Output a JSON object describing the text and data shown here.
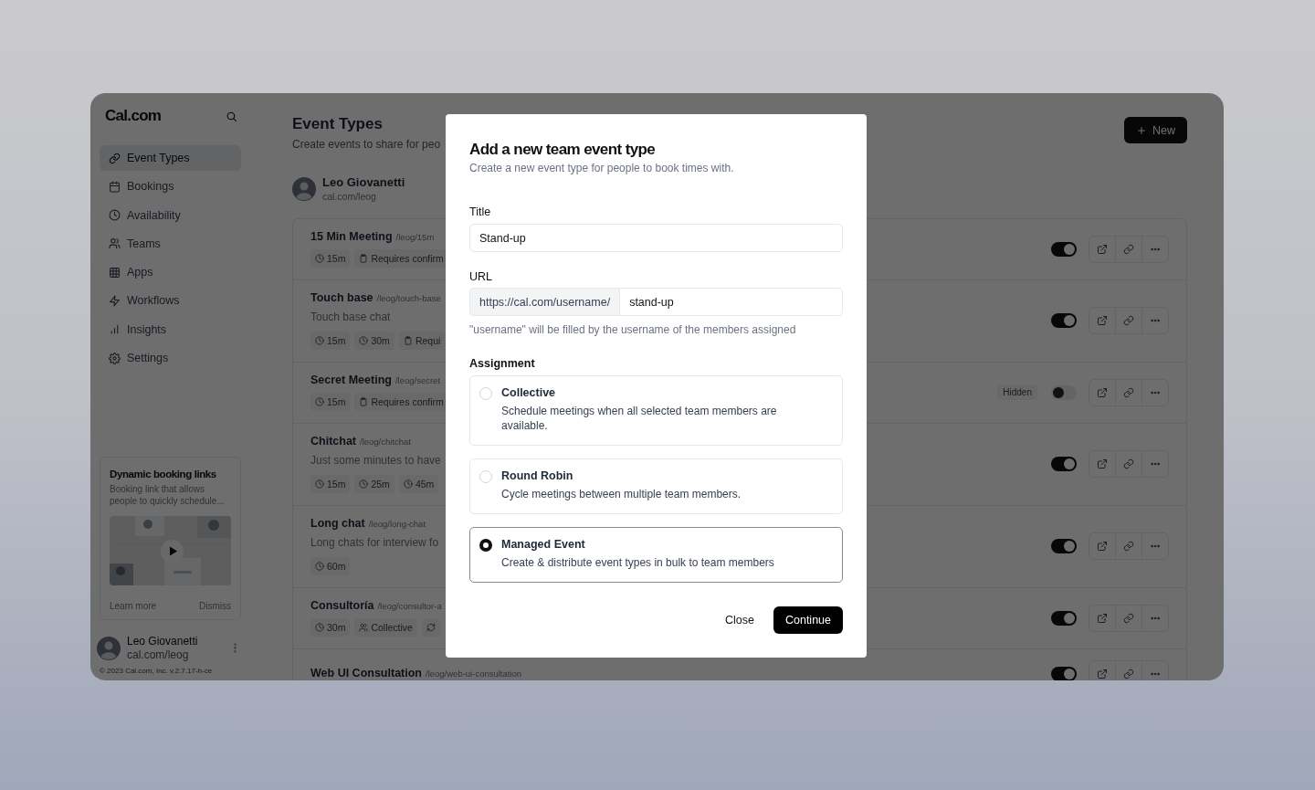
{
  "sidebar": {
    "logo": "Cal.com",
    "nav": [
      {
        "label": "Event Types",
        "selected": true
      },
      {
        "label": "Bookings",
        "selected": false
      },
      {
        "label": "Availability",
        "selected": false
      },
      {
        "label": "Teams",
        "selected": false
      },
      {
        "label": "Apps",
        "selected": false
      },
      {
        "label": "Workflows",
        "selected": false
      },
      {
        "label": "Insights",
        "selected": false
      },
      {
        "label": "Settings",
        "selected": false
      }
    ],
    "promo": {
      "title": "Dynamic booking links",
      "text": "Booking link that allows people to quickly schedule...",
      "learn_more": "Learn more",
      "dismiss": "Dismiss"
    },
    "user": {
      "name": "Leo Giovanetti",
      "handle": "cal.com/leog"
    },
    "footer": "© 2023 Cal.com, Inc. v.2.7.17-h-ce"
  },
  "main": {
    "title": "Event Types",
    "subtitle": "Create events to share for peo",
    "new_button": "New",
    "profile": {
      "name": "Leo Giovanetti",
      "handle": "cal.com/leog"
    },
    "events": [
      {
        "title": "15 Min Meeting",
        "slug": "/leog/15m",
        "badges": [
          {
            "kind": "duration",
            "label": "15m"
          },
          {
            "kind": "confirmation",
            "label": "Requires confirm"
          }
        ],
        "enabled": true
      },
      {
        "title": "Touch base",
        "slug": "/leog/touch-base",
        "description": "Touch base chat",
        "badges": [
          {
            "kind": "duration",
            "label": "15m"
          },
          {
            "kind": "duration",
            "label": "30m"
          },
          {
            "kind": "confirmation",
            "label": "Requi"
          }
        ],
        "enabled": true
      },
      {
        "title": "Secret Meeting",
        "slug": "/leog/secret",
        "badges": [
          {
            "kind": "duration",
            "label": "15m"
          },
          {
            "kind": "confirmation",
            "label": "Requires confirm"
          }
        ],
        "hidden_badge": "Hidden",
        "enabled": false
      },
      {
        "title": "Chitchat",
        "slug": "/leog/chitchat",
        "description": "Just some minutes to have",
        "badges": [
          {
            "kind": "duration",
            "label": "15m"
          },
          {
            "kind": "duration",
            "label": "25m"
          },
          {
            "kind": "duration",
            "label": "45m"
          }
        ],
        "enabled": true
      },
      {
        "title": "Long chat",
        "slug": "/leog/long-chat",
        "description": "Long chats for interview fo",
        "badges": [
          {
            "kind": "duration",
            "label": "60m"
          }
        ],
        "enabled": true
      },
      {
        "title": "Consultoría",
        "slug": "/leog/consultor-a",
        "badges": [
          {
            "kind": "duration",
            "label": "30m"
          },
          {
            "kind": "collective",
            "label": "Collective"
          },
          {
            "kind": "recurring"
          }
        ],
        "enabled": true
      },
      {
        "title": "Web UI Consultation",
        "slug": "/leog/web-ui-consultation",
        "enabled": true
      }
    ]
  },
  "modal": {
    "title": "Add a new team event type",
    "subtitle": "Create a new event type for people to book times with.",
    "title_field": {
      "label": "Title",
      "value": "Stand-up"
    },
    "url_field": {
      "label": "URL",
      "prefix": "https://cal.com/username/",
      "value": "stand-up",
      "hint": "\"username\" will be filled by the username of the members assigned"
    },
    "assignment": {
      "label": "Assignment",
      "options": [
        {
          "name": "Collective",
          "description": "Schedule meetings when all selected team members are available.",
          "selected": false
        },
        {
          "name": "Round Robin",
          "description": "Cycle meetings between multiple team members.",
          "selected": false
        },
        {
          "name": "Managed Event",
          "description": "Create & distribute event types in bulk to team members",
          "selected": true
        }
      ]
    },
    "close_button": "Close",
    "continue_button": "Continue"
  }
}
